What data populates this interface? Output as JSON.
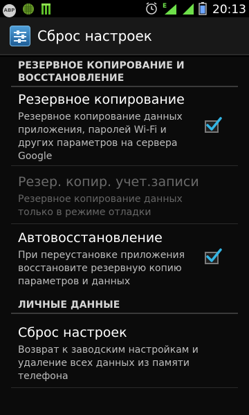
{
  "status_bar": {
    "left_icons": [
      "adblock-plus-icon",
      "android-bug-icon",
      "battery-charging-icon"
    ],
    "abp_text": "ABP",
    "right_icons": [
      "alarm-icon",
      "signal-icon-1",
      "signal-icon-2",
      "battery-icon"
    ],
    "network_label": "E",
    "time": "20:13"
  },
  "action_bar": {
    "icon": "settings-sliders-icon",
    "title": "Сброс настроек"
  },
  "sections": {
    "backup": {
      "header_line1": "РЕЗЕРВНОЕ КОПИРОВАНИЕ И",
      "header_line2": "ВОССТАНОВЛЕНИЕ"
    },
    "personal": {
      "header": "ЛИЧНЫЕ ДАННЫЕ"
    }
  },
  "prefs": {
    "backup_data": {
      "title": "Резервное копирование",
      "summary": "Резервное копирование данных приложения, паролей Wi-Fi и других параметров на сервера Google",
      "checked": true
    },
    "backup_account": {
      "title": "Резер. копир. учет.записи",
      "summary": "Резервное копирование данных только в режиме отладки",
      "enabled": false
    },
    "auto_restore": {
      "title": "Автовосстановление",
      "summary": "При переустановке приложения восстановите резервную копию параметров и данных",
      "checked": true
    },
    "factory_reset": {
      "title": "Сброс настроек",
      "summary": "Возврат к заводским настройкам и удаление всех данных из памяти телефона"
    }
  },
  "colors": {
    "check": "#33b5e5",
    "header_text": "#d6d6d6",
    "disabled_text": "#6a6a6a"
  }
}
